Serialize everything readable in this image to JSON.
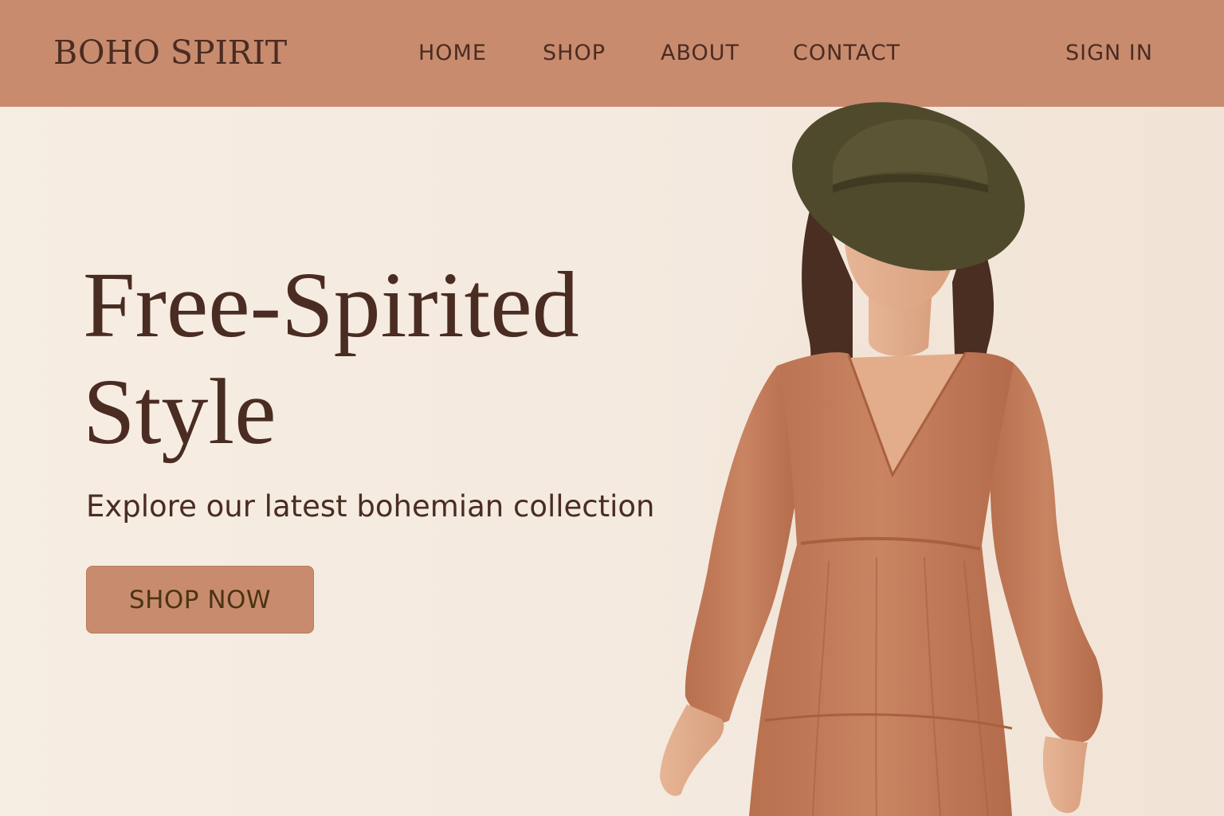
{
  "header": {
    "logo": "BOHO SPIRIT",
    "nav": {
      "home": "HOME",
      "shop": "SHOP",
      "about": "ABOUT",
      "contact": "CONTACT"
    },
    "sign_in": "SIGN IN"
  },
  "hero": {
    "title": "Free-Spirited Style",
    "subtitle": "Explore our latest bohemian collection",
    "cta_label": "SHOP NOW"
  },
  "colors": {
    "header_bg": "#c98b6e",
    "page_bg": "#f5ebe0",
    "text_dark": "#4a2c22",
    "button_bg": "#c98b6e",
    "button_text": "#4a3414",
    "hat": "#4f4a2c",
    "dress": "#c27e5f"
  }
}
